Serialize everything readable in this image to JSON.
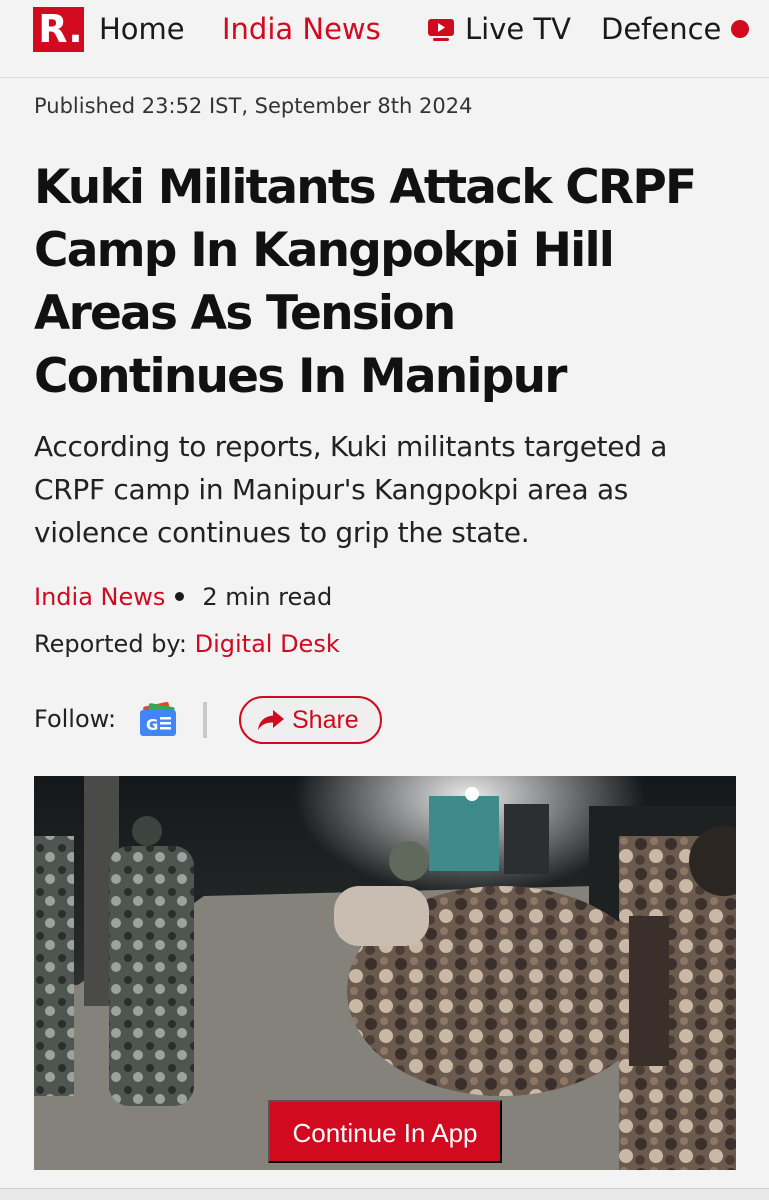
{
  "nav": {
    "logo": "R.",
    "home": "Home",
    "india_news": "India News",
    "live_tv": "Live TV",
    "defence": "Defence"
  },
  "article": {
    "published": "Published 23:52 IST, September 8th 2024",
    "headline_lines": [
      "Kuki Militants Attack CRPF",
      "Camp In Kangpokpi Hill",
      "Areas As Tension",
      "Continues In Manipur"
    ],
    "summary_lines": [
      "According to reports, Kuki militants targeted a",
      "CRPF camp in Manipur's Kangpokpi area as",
      "violence continues to grip the state."
    ],
    "category": "India News",
    "read_time": "2 min read",
    "reported_by_label": "Reported by:",
    "reporter": "Digital Desk",
    "follow_label": "Follow:",
    "share_label": "Share"
  },
  "cta": {
    "label": "Continue In App"
  },
  "colors": {
    "brand_red": "#d10a20",
    "background": "#f3f3f3"
  },
  "icons": {
    "tv": "tv-icon",
    "google_news": "google-news-icon",
    "share": "share-arrow-icon"
  }
}
